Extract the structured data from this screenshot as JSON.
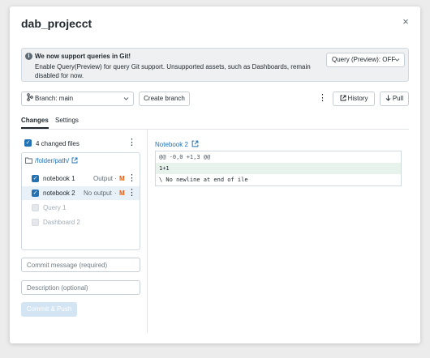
{
  "dialog": {
    "title": "dab_projecct",
    "close_glyph": "×"
  },
  "banner": {
    "icon": "info-icon",
    "title": "We now support queries in Git!",
    "body": "Enable Query(Preview) for query Git support. Unsupported assets, such as Dashboards, remain disabled for now.",
    "query_select_value": "Query (Preview): OFF"
  },
  "toolbar": {
    "branch_label": "Branch: main",
    "create_branch_label": "Create branch",
    "history_label": "History",
    "pull_label": "Pull"
  },
  "tabs": [
    {
      "label": "Changes",
      "active": true
    },
    {
      "label": "Settings",
      "active": false
    }
  ],
  "changes": {
    "summary": "4 changed files",
    "folder_path": "/folder/path/",
    "files": [
      {
        "name": "notebook 1",
        "output": "Output",
        "status": "M",
        "checked": true,
        "enabled": true
      },
      {
        "name": "notebook 2",
        "output": "No output",
        "status": "M",
        "checked": true,
        "enabled": true,
        "selected": true
      },
      {
        "name": "Query 1",
        "checked": false,
        "enabled": false
      },
      {
        "name": "Dashboard 2",
        "checked": false,
        "enabled": false
      }
    ],
    "separator": "·"
  },
  "commit": {
    "message_placeholder": "Commit message (required)",
    "description_placeholder": "Description (optional)",
    "button_label": "Commit & Push"
  },
  "diff": {
    "file_link": "Notebook 2",
    "lines": [
      "@@ -0,0 +1,3 @@",
      "1+1",
      "\\ No newline at end of ile"
    ]
  },
  "colors": {
    "accent": "#2272b4",
    "modified": "#e8590c",
    "added_bg": "#e7f2ea"
  }
}
